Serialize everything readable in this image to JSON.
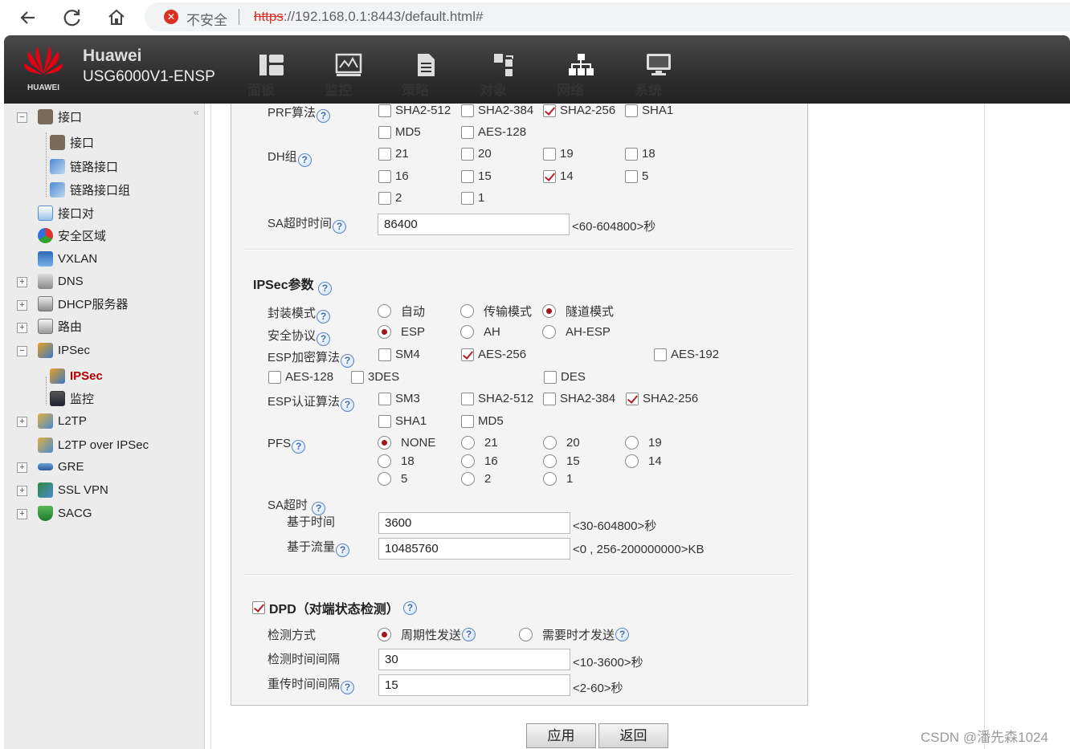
{
  "browser": {
    "insecure_label": "不安全",
    "url_scheme": "https",
    "url_rest": "://192.168.0.1:8443/default.html#"
  },
  "brand": {
    "name": "Huawei",
    "model": "USG6000V1-ENSP",
    "logo_text": "HUAWEI"
  },
  "topnav": [
    "面板",
    "监控",
    "策略",
    "对象",
    "网络",
    "系统"
  ],
  "sidebar": {
    "items": [
      "接口",
      "接口",
      "链路接口",
      "链路接口组",
      "接口对",
      "安全区域",
      "VXLAN",
      "DNS",
      "DHCP服务器",
      "路由",
      "IPSec",
      "IPSec",
      "监控",
      "L2TP",
      "L2TP over IPSec",
      "GRE",
      "SSL VPN",
      "SACG"
    ]
  },
  "ike": {
    "prf_label": "PRF算法",
    "prf_options": [
      "SHA2-512",
      "SHA2-384",
      "SHA2-256",
      "SHA1",
      "MD5",
      "AES-128"
    ],
    "dh_label": "DH组",
    "dh_options": [
      "21",
      "20",
      "19",
      "18",
      "16",
      "15",
      "14",
      "5",
      "2",
      "1"
    ],
    "sa_timeout_label": "SA超时时间",
    "sa_timeout_value": "86400",
    "sa_timeout_hint": "<60-604800>秒"
  },
  "ipsec": {
    "title": "IPSec参数",
    "encap_label": "封装模式",
    "encap_options": [
      "自动",
      "传输模式",
      "隧道模式"
    ],
    "proto_label": "安全协议",
    "proto_options": [
      "ESP",
      "AH",
      "AH-ESP"
    ],
    "enc_label": "ESP加密算法",
    "enc_options": [
      "SM4",
      "AES-256",
      "AES-192",
      "AES-128",
      "3DES",
      "DES"
    ],
    "auth_label": "ESP认证算法",
    "auth_options": [
      "SM3",
      "SHA2-512",
      "SHA2-384",
      "SHA2-256",
      "SHA1",
      "MD5"
    ],
    "pfs_label": "PFS",
    "pfs_options": [
      "NONE",
      "21",
      "20",
      "19",
      "18",
      "16",
      "15",
      "14",
      "5",
      "2",
      "1"
    ],
    "sa_label": "SA超时",
    "time_label": "基于时间",
    "time_value": "3600",
    "time_hint": "<30-604800>秒",
    "traffic_label": "基于流量",
    "traffic_value": "10485760",
    "traffic_hint": "<0 , 256-200000000>KB"
  },
  "dpd": {
    "title": "DPD（对端状态检测）",
    "mode_label": "检测方式",
    "mode_options": [
      "周期性发送",
      "需要时才发送"
    ],
    "interval_label": "检测时间间隔",
    "interval_value": "30",
    "interval_hint": "<10-3600>秒",
    "retry_label": "重传时间间隔",
    "retry_value": "15",
    "retry_hint": "<2-60>秒"
  },
  "buttons": {
    "apply": "应用",
    "back": "返回"
  },
  "watermark": "CSDN @潘先森1024"
}
